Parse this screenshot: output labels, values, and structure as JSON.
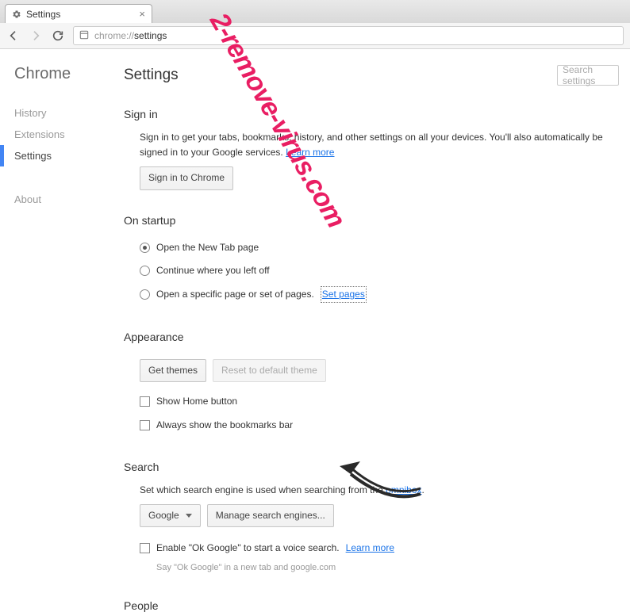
{
  "tab": {
    "title": "Settings"
  },
  "urlbar": {
    "protocol": "chrome://",
    "path": "settings"
  },
  "sidebar": {
    "title": "Chrome",
    "items": [
      "History",
      "Extensions",
      "Settings"
    ],
    "about": "About"
  },
  "page": {
    "title": "Settings",
    "search_placeholder": "Search settings"
  },
  "signin": {
    "title": "Sign in",
    "text": "Sign in to get your tabs, bookmarks, history, and other settings on all your devices. You'll also automatically be signed in to your Google services. ",
    "learn_more": "Learn more",
    "button": "Sign in to Chrome"
  },
  "startup": {
    "title": "On startup",
    "options": [
      "Open the New Tab page",
      "Continue where you left off",
      "Open a specific page or set of pages. "
    ],
    "set_pages": "Set pages"
  },
  "appearance": {
    "title": "Appearance",
    "get_themes": "Get themes",
    "reset_theme": "Reset to default theme",
    "show_home": "Show Home button",
    "show_bookmarks": "Always show the bookmarks bar"
  },
  "search": {
    "title": "Search",
    "text_pre": "Set which search engine is used when searching from the ",
    "omnibox": "omnibox",
    "text_post": ".",
    "engine": "Google",
    "manage": "Manage search engines...",
    "ok_google": "Enable \"Ok Google\" to start a voice search. ",
    "learn_more": "Learn more",
    "hint": "Say \"Ok Google\" in a new tab and google.com"
  },
  "people": {
    "title": "People"
  },
  "watermark": "2-remove-virus.com"
}
